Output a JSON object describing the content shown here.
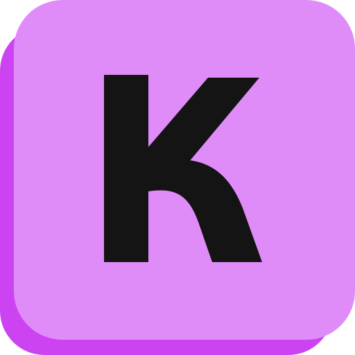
{
  "key": {
    "letter": "K",
    "face_color": "#e08cf8",
    "shadow_color": "#cc44f2",
    "glyph_color": "#141414"
  }
}
